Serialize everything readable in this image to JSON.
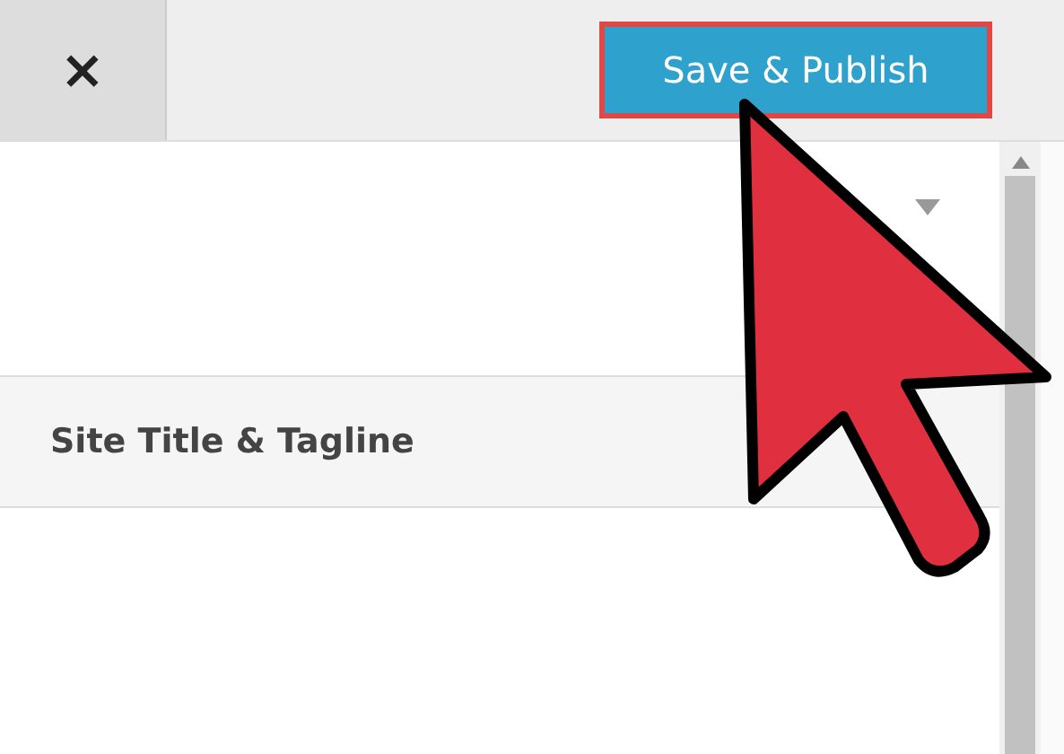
{
  "header": {
    "close_label": "×",
    "save_button": "Save & Publish"
  },
  "sections": [
    {
      "title": "Site Title & Tagline"
    }
  ]
}
